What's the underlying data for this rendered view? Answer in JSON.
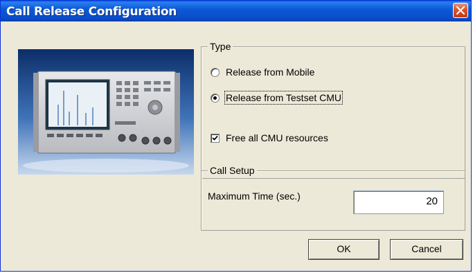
{
  "window": {
    "title": "Call Release Configuration"
  },
  "type_group": {
    "legend": "Type",
    "release_from_mobile": {
      "label": "Release from Mobile",
      "selected": false
    },
    "release_from_testset": {
      "label": "Release from Testset CMU",
      "selected": true
    },
    "free_all_resources": {
      "label": "Free all CMU resources",
      "checked": true
    }
  },
  "call_setup_group": {
    "legend": "Call Setup",
    "max_time_label": "Maximum Time (sec.)",
    "max_time_value": "20"
  },
  "buttons": {
    "ok": "OK",
    "cancel": "Cancel"
  },
  "icons": {
    "close": "close-icon",
    "check": "checkmark-icon"
  },
  "colors": {
    "titlebar": "#0a4cc9",
    "dialog_bg": "#ece9d8",
    "close_button": "#d9582f"
  }
}
